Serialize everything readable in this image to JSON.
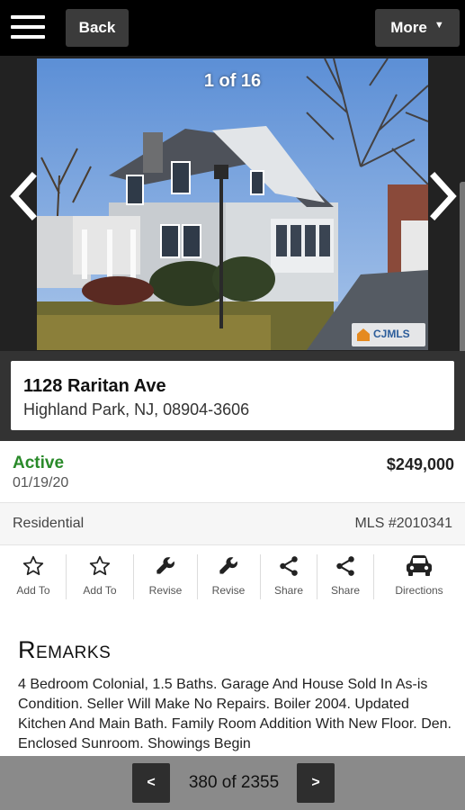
{
  "header": {
    "back_label": "Back",
    "more_label": "More",
    "more_caret": "▼"
  },
  "gallery": {
    "counter": "1 of 16",
    "watermark": "CJMLS"
  },
  "address": {
    "street": "1128 Raritan Ave",
    "city_line": "Highland Park, NJ, 08904-3606"
  },
  "listing": {
    "status": "Active",
    "date": "01/19/20",
    "price": "$249,000",
    "type": "Residential",
    "mls": "MLS #2010341"
  },
  "actions": [
    {
      "label": "Add To",
      "icon": "star-icon"
    },
    {
      "label": "Add To",
      "icon": "star-icon"
    },
    {
      "label": "Revise",
      "icon": "wrench-icon"
    },
    {
      "label": "Revise",
      "icon": "wrench-icon"
    },
    {
      "label": "Share",
      "icon": "share-icon"
    },
    {
      "label": "Share",
      "icon": "share-icon"
    },
    {
      "label": "Directions",
      "icon": "car-icon"
    }
  ],
  "remarks": {
    "title": "Remarks",
    "text": "4 Bedroom Colonial, 1.5 Baths. Garage And House Sold In As-is Condition. Seller Will Make No Repairs. Boiler 2004. Updated Kitchen And Main Bath. Family Room Addition With New Floor. Den. Enclosed Sunroom. Showings Begin"
  },
  "pager": {
    "prev": "<",
    "label": "380 of 2355",
    "next": ">"
  },
  "colors": {
    "status_active": "#2a8a2a",
    "topbar": "#000000",
    "button": "#3b3b3b"
  }
}
